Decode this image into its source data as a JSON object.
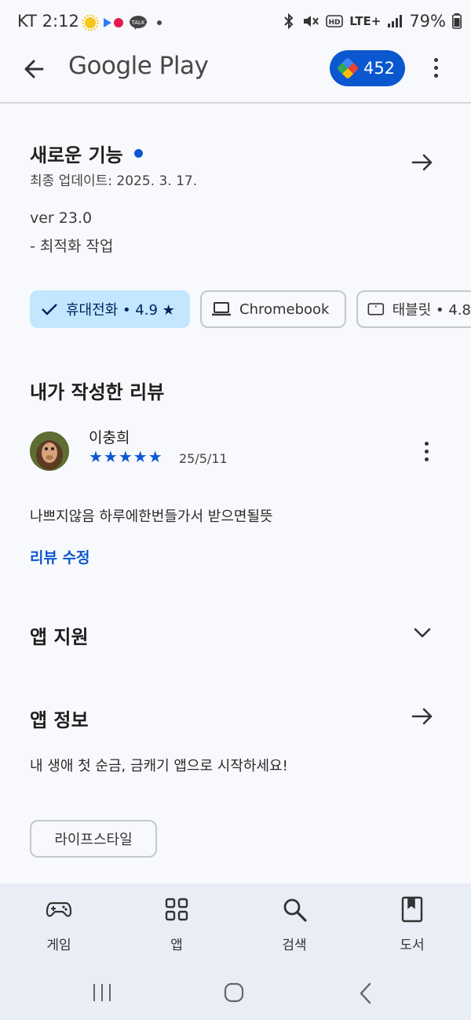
{
  "status_bar": {
    "carrier_time": "KT 2:12",
    "battery": "79%",
    "network": "LTE+"
  },
  "app_bar": {
    "title": "Google Play",
    "points": "452"
  },
  "whats_new": {
    "title": "새로운 기능",
    "updated": "최종 업데이트: 2025. 3. 17.",
    "notes": [
      "ver 23.0",
      "- 최적화 작업"
    ]
  },
  "device_chips": [
    {
      "label": "휴대전화 • 4.9 ★",
      "selected": true
    },
    {
      "label": "Chromebook",
      "selected": false
    },
    {
      "label": "태블릿 • 4.8",
      "selected": false
    }
  ],
  "my_review": {
    "section_title": "내가 작성한 리뷰",
    "author": "이충희",
    "stars": "★★★★★",
    "rating": 5,
    "date": "25/5/11",
    "text": "나쁘지않음 하루에한번들가서 받으면될뜻",
    "edit_link": "리뷰 수정"
  },
  "app_support": {
    "title": "앱 지원"
  },
  "app_info": {
    "title": "앱 정보",
    "description": "내 생애 첫 순금, 금캐기 앱으로 시작하세요!",
    "category": "라이프스타일"
  },
  "bottom_nav": [
    {
      "label": "게임",
      "icon": "gamepad-icon"
    },
    {
      "label": "앱",
      "icon": "apps-grid-icon"
    },
    {
      "label": "검색",
      "icon": "search-icon"
    },
    {
      "label": "도서",
      "icon": "book-icon"
    }
  ],
  "colors": {
    "accent": "#0b57d0",
    "selected_chip": "#c2e7ff",
    "nav_bg": "#e9edf5"
  }
}
